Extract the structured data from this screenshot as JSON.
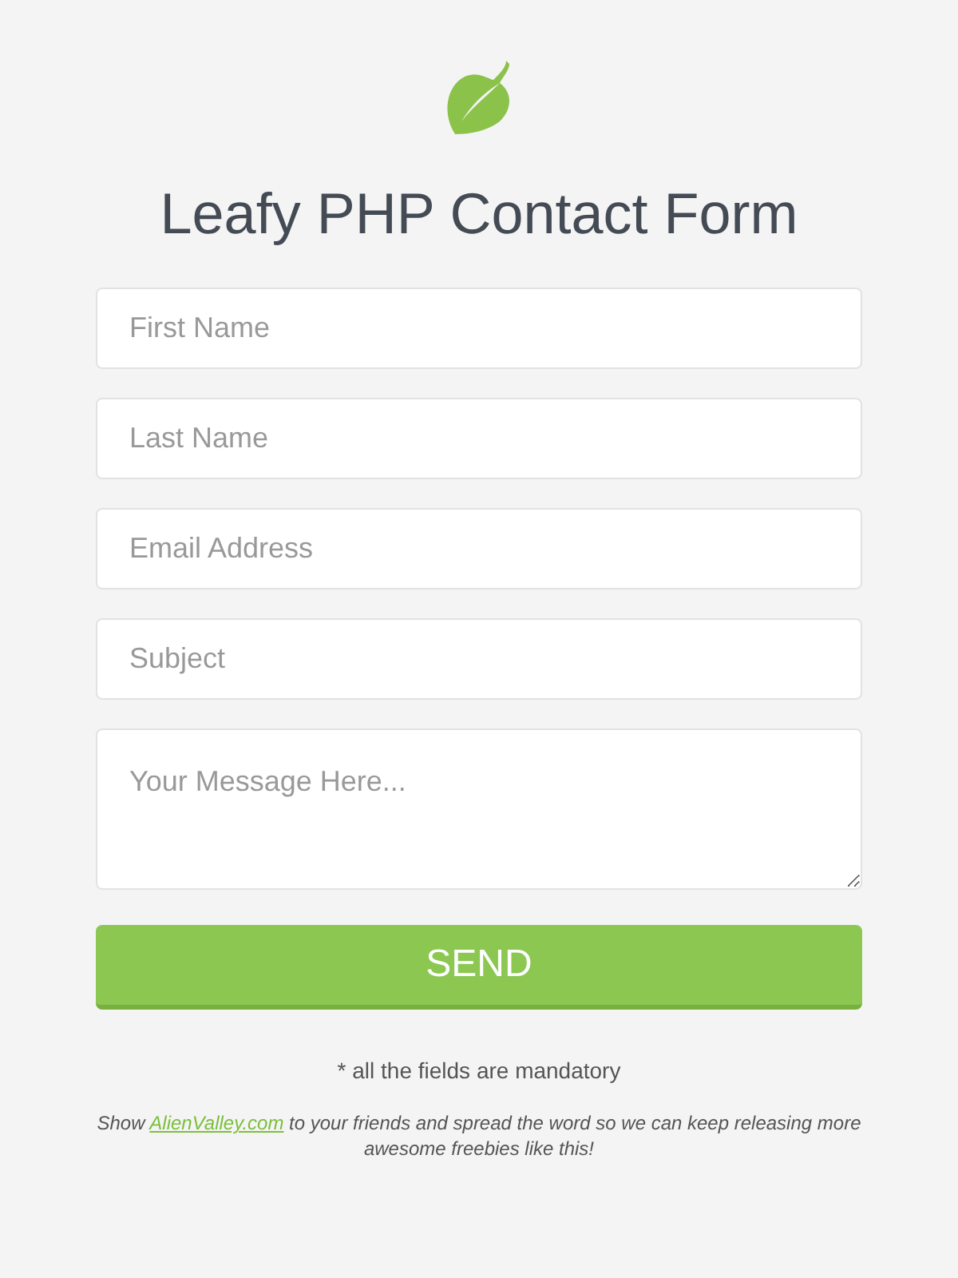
{
  "title": "Leafy PHP Contact Form",
  "fields": [
    {
      "kind": "input",
      "placeholder": "First Name"
    },
    {
      "kind": "input",
      "placeholder": "Last Name"
    },
    {
      "kind": "input",
      "placeholder": "Email Address"
    },
    {
      "kind": "input",
      "placeholder": "Subject"
    },
    {
      "kind": "textarea",
      "placeholder": "Your Message Here..."
    }
  ],
  "submit_button": "SEND",
  "note": "* all the fields are mandatory",
  "promo": {
    "before": "Show ",
    "link": "AlienValley.com",
    "after": " to your friends and spread the word so we can keep releasing more awesome freebies like this!"
  }
}
